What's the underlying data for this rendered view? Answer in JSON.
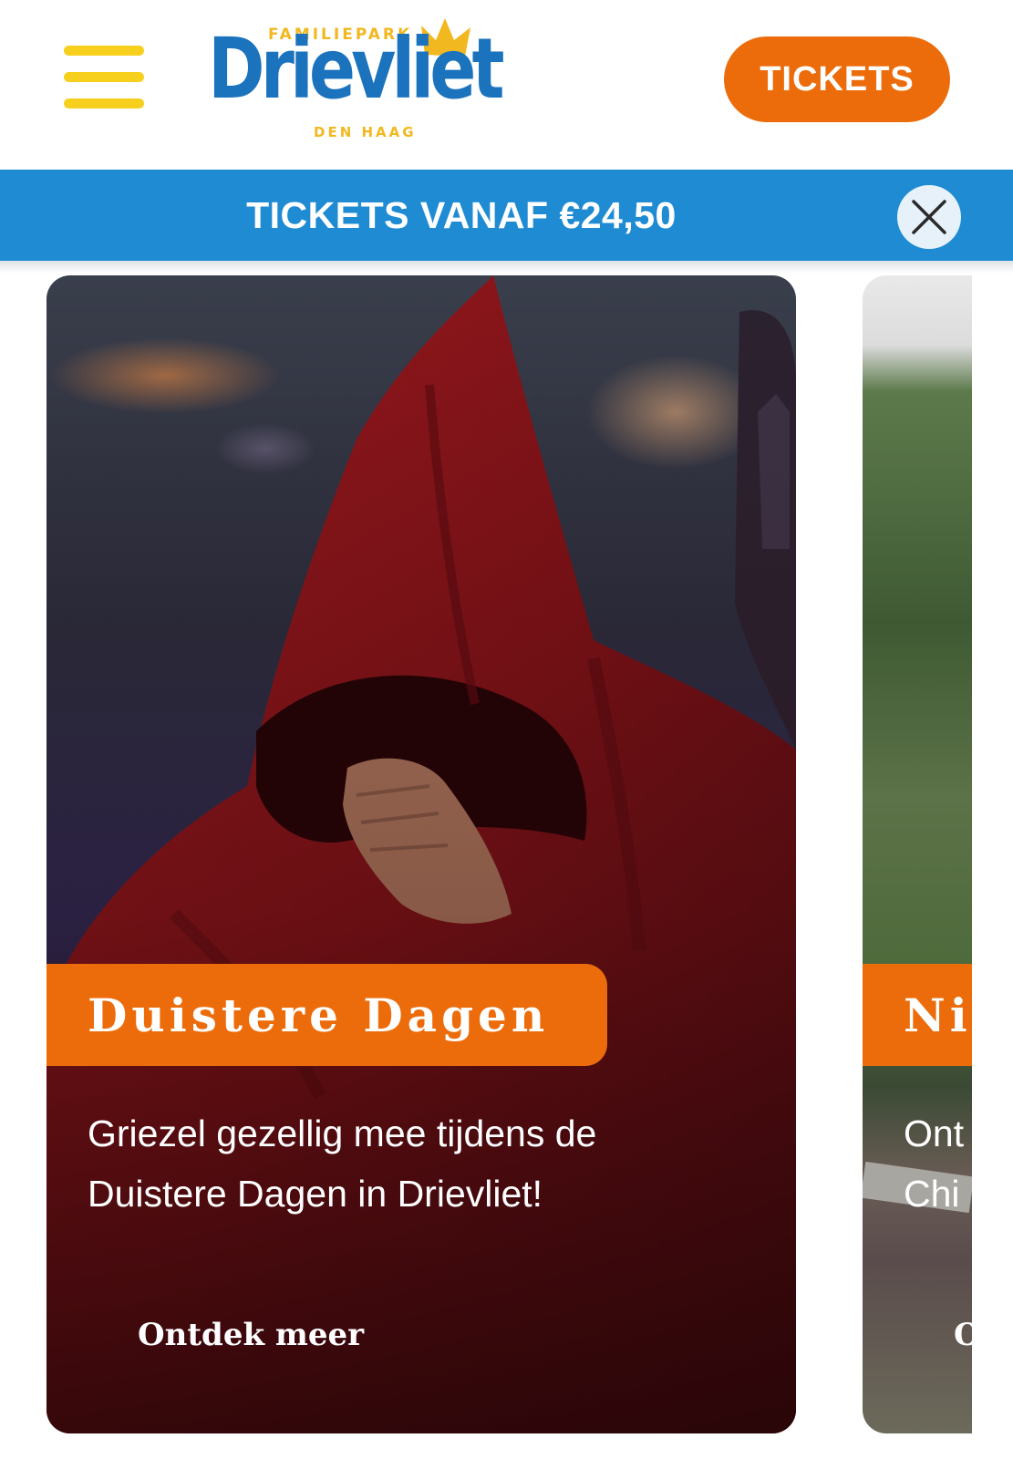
{
  "header": {
    "menu_icon": "hamburger-menu-icon",
    "logo": {
      "top_text": "FAMILIEPARK",
      "name": "Drievliet",
      "bottom_text": "DEN HAAG",
      "colors": {
        "wordmark": "#1b73bd",
        "accent": "#f2b81f"
      }
    },
    "tickets_label": "TICKETS"
  },
  "promo_bar": {
    "text": "TICKETS VANAF €24,50",
    "close_icon": "close-icon",
    "background": "#1e8bd3"
  },
  "cards": [
    {
      "title": "Duistere Dagen",
      "description": "Griezel gezellig mee tijdens de Duistere Dagen in Drievliet!",
      "cta": "Ontdek meer",
      "image": "red-hooded-figure-photo"
    },
    {
      "title": "Ni",
      "description_line1": "Ont",
      "description_line2": "Chi",
      "cta": "O",
      "image": "ride-trees-photo"
    }
  ],
  "colors": {
    "accent_orange": "#ec6c0b",
    "menu_yellow": "#f7cf1d"
  }
}
